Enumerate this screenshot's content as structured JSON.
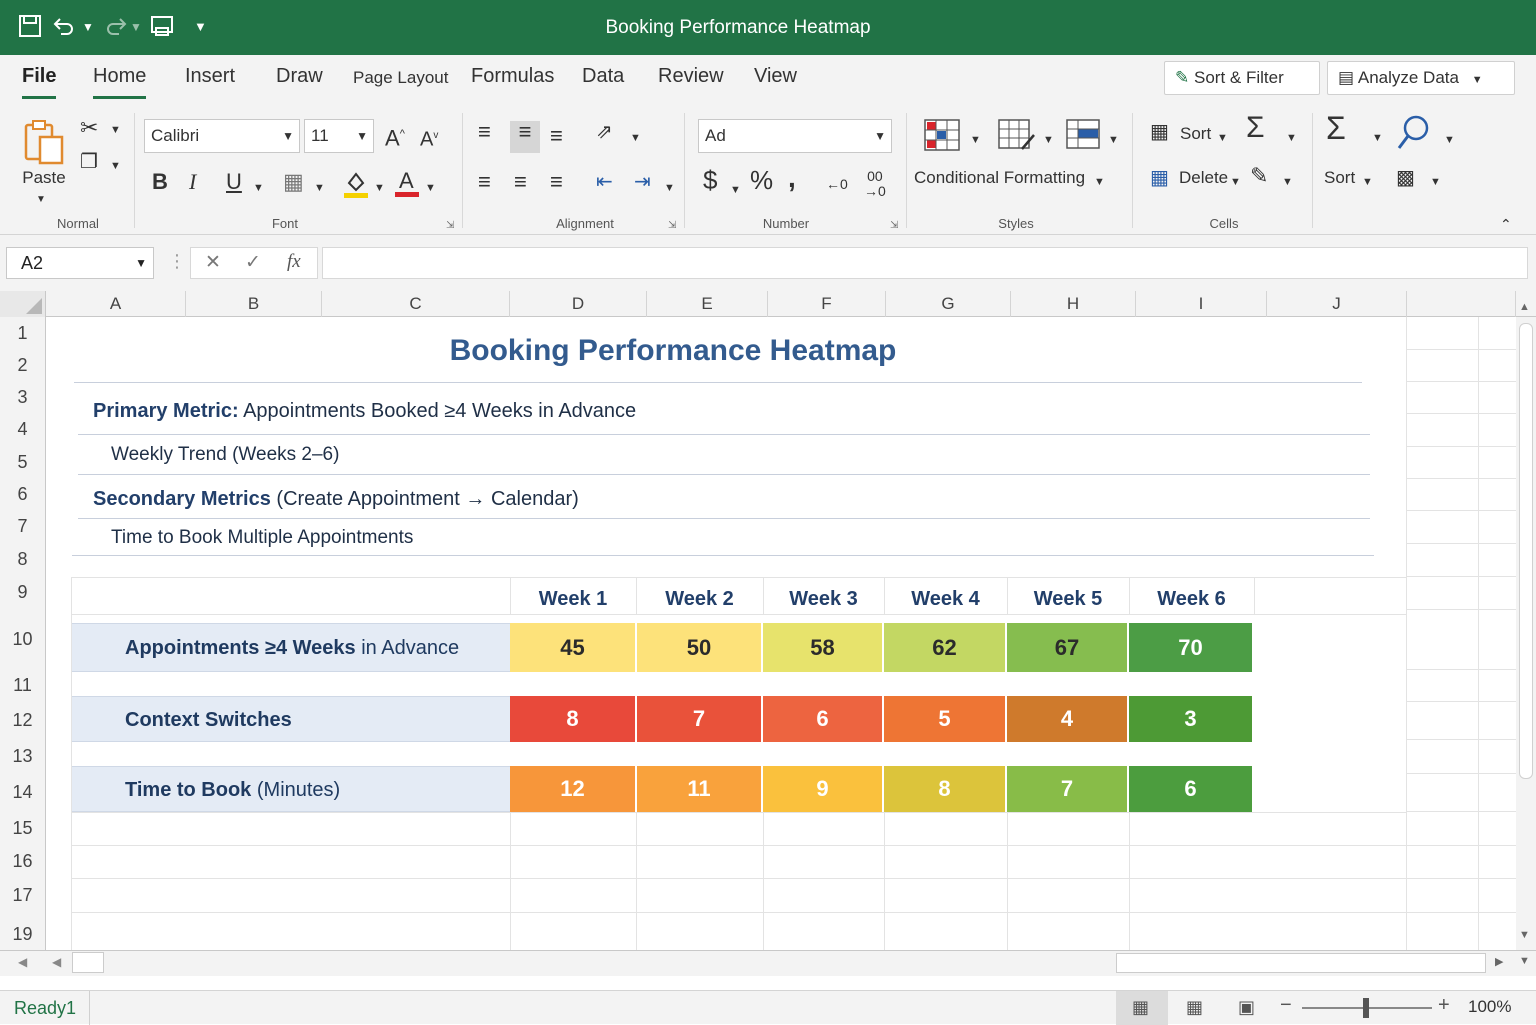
{
  "window": {
    "title": "Booking Performance Heatmap"
  },
  "quick_access": {
    "save_icon": "save-icon",
    "undo_icon": "undo-icon",
    "redo_icon": "redo-icon",
    "print_icon": "print-preview-icon",
    "customize_icon": "customize-icon"
  },
  "tabs": [
    "File",
    "Home",
    "Insert",
    "Draw",
    "Page Layout",
    "Formulas",
    "Data",
    "Review",
    "View"
  ],
  "top_buttons": {
    "sort_filter": "Sort & Filter",
    "analyze_data": "Analyze Data"
  },
  "ribbon": {
    "paste": "Paste",
    "normal_group": "Normal",
    "font_name": "Calibri",
    "font_size": "11",
    "font_group": "Font",
    "bold": "B",
    "italic": "I",
    "underline": "U",
    "alignment_group": "Alignment",
    "number_format": "Ad",
    "number_group": "Number",
    "currency": "$",
    "percent": "%",
    "comma": ",",
    "conditional_formatting": "Conditional Formatting",
    "styles_group": "Styles",
    "sort": "Sort",
    "delete": "Delete",
    "sort2": "Sort",
    "cells_group": "Cells"
  },
  "formula_bar": {
    "name_box": "A2",
    "fx": "fx",
    "cancel": "✕",
    "enter": "✓",
    "formula": ""
  },
  "columns": [
    "A",
    "B",
    "C",
    "D",
    "E",
    "F",
    "G",
    "H",
    "I",
    "J"
  ],
  "rows": [
    "1",
    "2",
    "3",
    "4",
    "5",
    "6",
    "7",
    "8",
    "9",
    "10",
    "11",
    "12",
    "13",
    "14",
    "15",
    "16",
    "17",
    "19"
  ],
  "sheet": {
    "title": "Booking Performance Heatmap",
    "primary_label": "Primary Metric:",
    "primary_text": "Appointments Booked ≥4 Weeks in Advance",
    "weekly_trend": "Weekly Trend (Weeks 2–6)",
    "secondary_label": "Secondary Metrics",
    "secondary_text": "(Create Appointment → Calendar)",
    "time_multi": "Time to Book Multiple Appointments"
  },
  "heatmap": {
    "weeks": [
      "Week 1",
      "Week 2",
      "Week 3",
      "Week 4",
      "Week 5",
      "Week 6"
    ],
    "rows": [
      {
        "bold": "Appointments ≥4 Weeks",
        "rest": " in Advance",
        "values": [
          "45",
          "50",
          "58",
          "62",
          "67",
          "70"
        ],
        "colors": [
          "#fde27a",
          "#fde27a",
          "#e7e36c",
          "#c3d763",
          "#86bd4f",
          "#4c9d45"
        ],
        "text_colors": [
          "#2b2b2b",
          "#2b2b2b",
          "#2b2b2b",
          "#2b2b2b",
          "#2b2b2b",
          "#ffffff"
        ]
      },
      {
        "bold": "Context Switches",
        "rest": "",
        "values": [
          "8",
          "7",
          "6",
          "5",
          "4",
          "3"
        ],
        "colors": [
          "#e8493a",
          "#e9523a",
          "#ed6440",
          "#ee7534",
          "#cf7a2c",
          "#4d9a35"
        ],
        "text_colors": [
          "#ffffff",
          "#ffffff",
          "#ffffff",
          "#ffffff",
          "#ffffff",
          "#ffffff"
        ]
      },
      {
        "bold": "Time to Book",
        "rest": " (Minutes)",
        "values": [
          "12",
          "11",
          "9",
          "8",
          "7",
          "6"
        ],
        "colors": [
          "#f7963a",
          "#f9a23c",
          "#fac13d",
          "#dcc43b",
          "#88bc48",
          "#4c9d3e"
        ],
        "text_colors": [
          "#ffffff",
          "#ffffff",
          "#ffffff",
          "#ffffff",
          "#ffffff",
          "#ffffff"
        ]
      }
    ]
  },
  "status": {
    "ready": "Ready1",
    "zoom": "100%"
  }
}
